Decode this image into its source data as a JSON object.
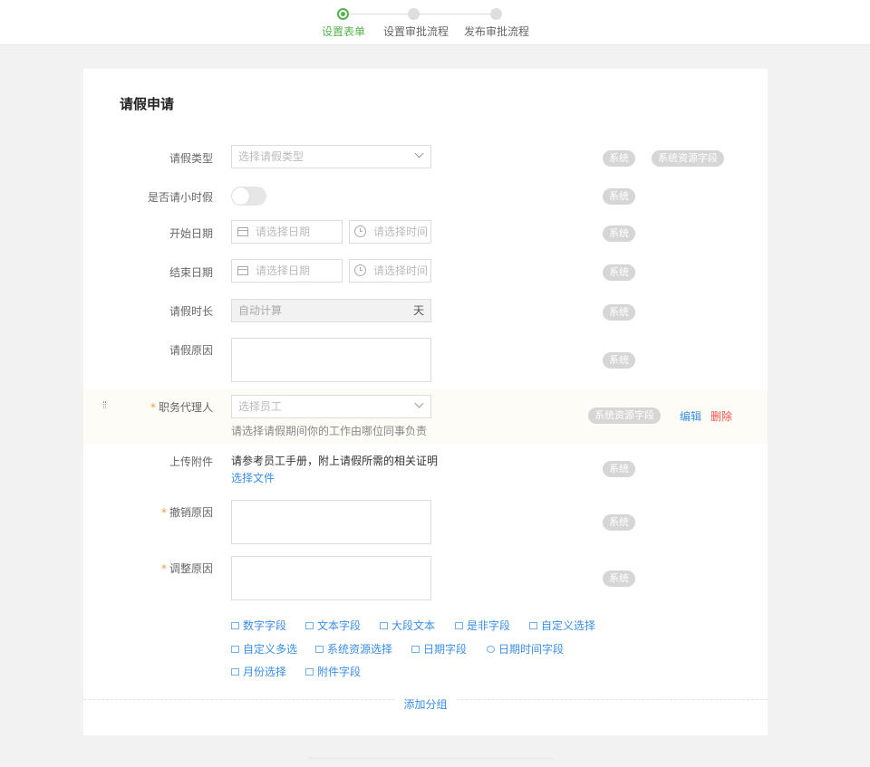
{
  "stepper": {
    "steps": [
      {
        "label": "设置表单",
        "active": true
      },
      {
        "label": "设置审批流程",
        "active": false
      },
      {
        "label": "发布审批流程",
        "active": false
      }
    ]
  },
  "form": {
    "title": "请假申请",
    "fields": {
      "leave_type": {
        "label": "请假类型",
        "placeholder": "选择请假类型",
        "tags": [
          "系统",
          "系统资源字段"
        ]
      },
      "hourly": {
        "label": "是否请小时假",
        "tags": [
          "系统"
        ],
        "enabled": false
      },
      "start_date": {
        "label": "开始日期",
        "date_placeholder": "请选择日期",
        "time_placeholder": "请选择时间",
        "tags": [
          "系统"
        ]
      },
      "end_date": {
        "label": "结束日期",
        "date_placeholder": "请选择日期",
        "time_placeholder": "请选择时间",
        "tags": [
          "系统"
        ]
      },
      "duration": {
        "label": "请假时长",
        "value": "自动计算",
        "unit": "天",
        "tags": [
          "系统"
        ]
      },
      "reason": {
        "label": "请假原因",
        "tags": [
          "系统"
        ]
      },
      "delegate": {
        "label": "职务代理人",
        "required": "*",
        "placeholder": "选择员工",
        "hint": "请选择请假期间你的工作由哪位同事负责",
        "tags": [
          "系统资源字段"
        ],
        "edit_label": "编辑",
        "delete_label": "删除"
      },
      "attachment": {
        "label": "上传附件",
        "description": "请参考员工手册，附上请假所需的相关证明",
        "choose_label": "选择文件",
        "tags": [
          "系统"
        ]
      },
      "cancel_reason": {
        "label": "撤销原因",
        "required": "*",
        "tags": [
          "系统"
        ]
      },
      "adjust_reason": {
        "label": "调整原因",
        "required": "*",
        "tags": [
          "系统"
        ]
      }
    },
    "field_types": [
      {
        "label": "数字字段",
        "icon": "number-icon"
      },
      {
        "label": "文本字段",
        "icon": "text-icon"
      },
      {
        "label": "大段文本",
        "icon": "paragraph-icon"
      },
      {
        "label": "是非字段",
        "icon": "boolean-icon"
      },
      {
        "label": "自定义选择",
        "icon": "select-icon"
      },
      {
        "label": "自定义多选",
        "icon": "multiselect-icon"
      },
      {
        "label": "系统资源选择",
        "icon": "resource-icon"
      },
      {
        "label": "日期字段",
        "icon": "date-icon"
      },
      {
        "label": "日期时间字段",
        "icon": "clock-icon"
      },
      {
        "label": "月份选择",
        "icon": "month-icon"
      },
      {
        "label": "附件字段",
        "icon": "attachment-icon"
      }
    ],
    "add_group_label": "添加分组"
  },
  "colors": {
    "accent_green": "#52b44b",
    "link_blue": "#3a8ee6",
    "delete_red": "#f0504a",
    "required_orange": "#f09a3e",
    "tag_gray": "#d6d6d6"
  }
}
